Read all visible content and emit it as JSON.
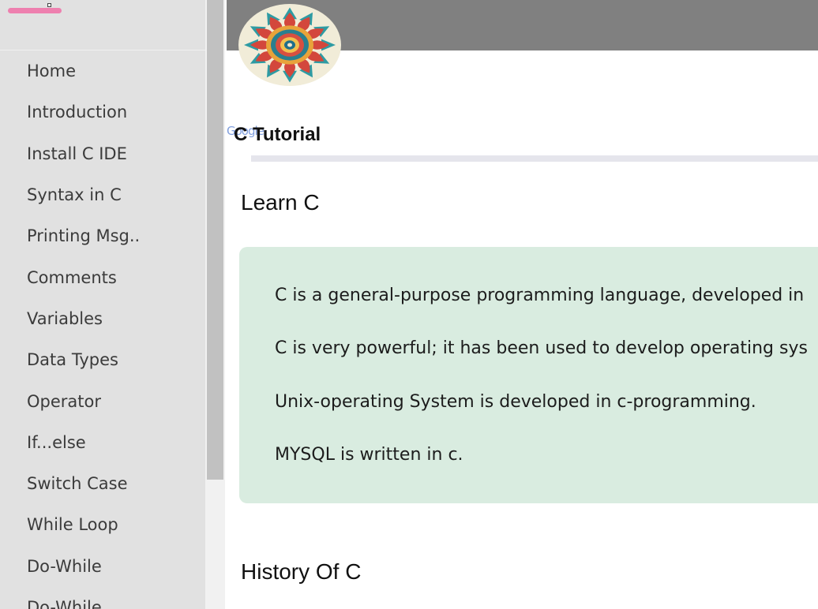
{
  "sidebar": {
    "items": [
      {
        "label": "Home"
      },
      {
        "label": "Introduction"
      },
      {
        "label": "Install C IDE"
      },
      {
        "label": "Syntax in C"
      },
      {
        "label": "Printing Msg.."
      },
      {
        "label": "Comments"
      },
      {
        "label": "Variables"
      },
      {
        "label": "Data Types"
      },
      {
        "label": "Operator"
      },
      {
        "label": "If...else"
      },
      {
        "label": "Switch Case"
      },
      {
        "label": "While Loop"
      },
      {
        "label": "Do-While"
      },
      {
        "label": "Do-While"
      }
    ]
  },
  "header": {
    "google_mark": "Google",
    "title": "C Tutorial"
  },
  "main": {
    "learn_heading": "Learn C",
    "paragraphs": [
      "C is a general-purpose programming language, developed in",
      "C is very powerful; it has been used to develop operating sys",
      "Unix-operating System is developed in c-programming.",
      "MYSQL is written in c."
    ],
    "history_heading": "History Of C"
  },
  "colors": {
    "sidebar_bg": "#e1e1e1",
    "header_bar": "#808080",
    "info_box": "#d9ece0",
    "logo_pink": "#f06fa6"
  },
  "icons": [
    "mandala-logo",
    "google-logo"
  ]
}
